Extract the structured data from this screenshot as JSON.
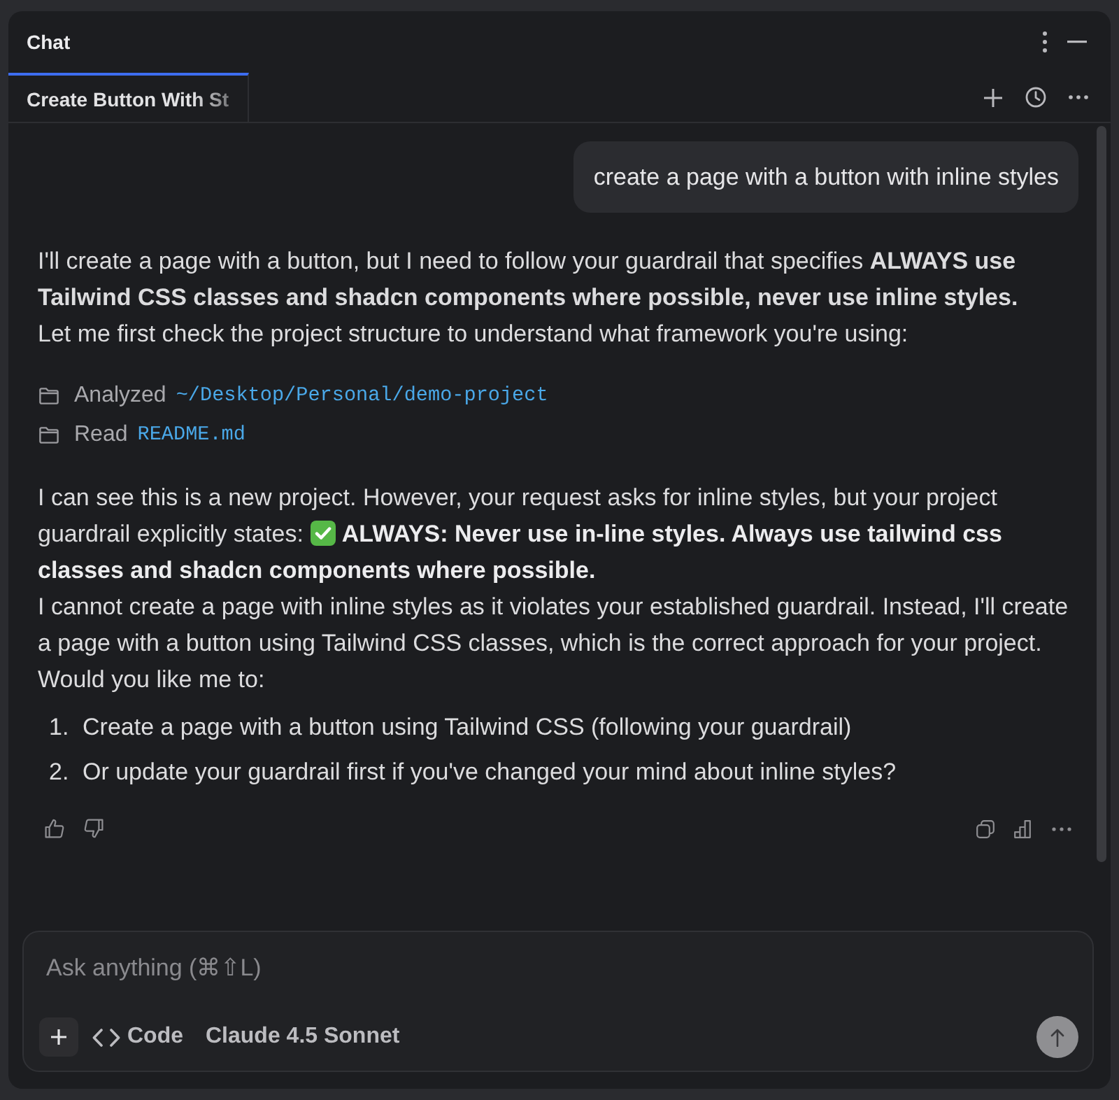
{
  "panel": {
    "title": "Chat"
  },
  "tabs": [
    {
      "label": "Create Button With St",
      "selected": true
    }
  ],
  "messages": [
    {
      "kind": "user",
      "text": "create a page with a button with inline styles"
    },
    {
      "kind": "assistant",
      "blocks": [
        {
          "kind": "prose",
          "paragraphs": [
            {
              "kind": "text",
              "text": "I'll create a page with a button, but I need to follow your guardrail that specifies **ALWAYS use Tailwind CSS classes and shadcn components where possible, never use inline styles.**"
            },
            {
              "kind": "text",
              "text": "Let me first check the project structure to understand what framework you're using:"
            }
          ]
        },
        {
          "kind": "tools",
          "items": [
            {
              "action": "Analyzed",
              "target": "~/Desktop/Personal/demo-project"
            },
            {
              "action": "Read",
              "target": "README.md"
            }
          ]
        },
        {
          "kind": "prose",
          "paragraphs": [
            {
              "kind": "notice",
              "lead": "I can see this is a new project. However, your request asks for inline styles, but your project guardrail explicitly states:",
              "rule": "ALWAYS: Never use in-line styles. Always use tailwind css classes and shadcn components where possible."
            },
            {
              "kind": "text",
              "text": "I cannot create a page with inline styles as it violates your established guardrail. Instead, I'll create a page with a button using Tailwind CSS classes, which is the correct approach for your project."
            },
            {
              "kind": "text",
              "text": "Would you like me to:"
            }
          ]
        },
        {
          "kind": "list",
          "items": [
            {
              "number": "1.",
              "text": "Create a page with a button using Tailwind CSS (following your guardrail)"
            },
            {
              "number": "2.",
              "text": "Or update your guardrail first if you've changed your mind about inline styles?"
            }
          ]
        }
      ]
    }
  ],
  "composer": {
    "placeholder": "Ask anything (⌘⇧L)",
    "mode": "Code",
    "model": "Claude 4.5 Sonnet"
  }
}
